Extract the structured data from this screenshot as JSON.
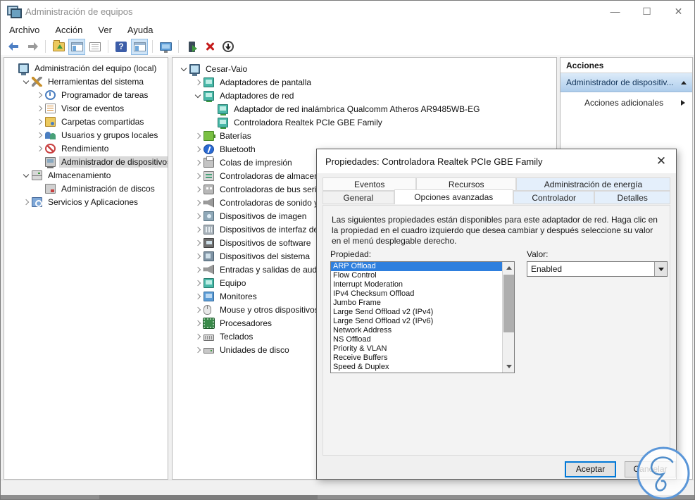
{
  "window": {
    "title": "Administración de equipos",
    "controls": {
      "minimize": "—",
      "maximize": "☐",
      "close": "✕"
    }
  },
  "menu": {
    "items": [
      "Archivo",
      "Acción",
      "Ver",
      "Ayuda"
    ]
  },
  "toolbar": {
    "help_glyph": "?"
  },
  "left_tree": {
    "items": [
      {
        "label": "Administración del equipo (local)",
        "icon": "computer-mgmt",
        "level": 0,
        "expand": "none",
        "selected": false
      },
      {
        "label": "Herramientas del sistema",
        "icon": "tools",
        "level": 1,
        "expand": "down",
        "selected": false
      },
      {
        "label": "Programador de tareas",
        "icon": "scheduler",
        "level": 2,
        "expand": "right",
        "selected": false
      },
      {
        "label": "Visor de eventos",
        "icon": "event-viewer",
        "level": 2,
        "expand": "right",
        "selected": false
      },
      {
        "label": "Carpetas compartidas",
        "icon": "shared-folders",
        "level": 2,
        "expand": "right",
        "selected": false
      },
      {
        "label": "Usuarios y grupos locales",
        "icon": "users",
        "level": 2,
        "expand": "right",
        "selected": false
      },
      {
        "label": "Rendimiento",
        "icon": "performance",
        "level": 2,
        "expand": "right",
        "selected": false
      },
      {
        "label": "Administrador de dispositivos",
        "icon": "device-manager",
        "level": 2,
        "expand": "none",
        "selected": true
      },
      {
        "label": "Almacenamiento",
        "icon": "storage",
        "level": 1,
        "expand": "down",
        "selected": false
      },
      {
        "label": "Administración de discos",
        "icon": "disk-mgmt",
        "level": 2,
        "expand": "none",
        "selected": false
      },
      {
        "label": "Servicios y Aplicaciones",
        "icon": "services",
        "level": 1,
        "expand": "right",
        "selected": false
      }
    ]
  },
  "device_tree": {
    "items": [
      {
        "label": "Cesar-Vaio",
        "icon": "computer",
        "level": 0,
        "expand": "down",
        "selected": false
      },
      {
        "label": "Adaptadores de pantalla",
        "icon": "display",
        "level": 1,
        "expand": "right",
        "selected": false
      },
      {
        "label": "Adaptadores de red",
        "icon": "network",
        "level": 1,
        "expand": "down",
        "selected": false
      },
      {
        "label": "Adaptador de red inalámbrica Qualcomm Atheros AR9485WB-EG",
        "icon": "network",
        "level": 2,
        "expand": "none",
        "selected": false
      },
      {
        "label": "Controladora Realtek PCIe GBE Family",
        "icon": "network",
        "level": 2,
        "expand": "none",
        "selected": false
      },
      {
        "label": "Baterías",
        "icon": "battery",
        "level": 1,
        "expand": "right",
        "selected": false
      },
      {
        "label": "Bluetooth",
        "icon": "bluetooth",
        "level": 1,
        "expand": "right",
        "selected": false
      },
      {
        "label": "Colas de impresión",
        "icon": "printer",
        "level": 1,
        "expand": "right",
        "selected": false
      },
      {
        "label": "Controladoras de almacena",
        "icon": "storage-ctrl",
        "level": 1,
        "expand": "right",
        "selected": false
      },
      {
        "label": "Controladoras de bus serie",
        "icon": "usb",
        "level": 1,
        "expand": "right",
        "selected": false
      },
      {
        "label": "Controladoras de sonido y",
        "icon": "sound",
        "level": 1,
        "expand": "right",
        "selected": false
      },
      {
        "label": "Dispositivos de imagen",
        "icon": "imaging",
        "level": 1,
        "expand": "right",
        "selected": false
      },
      {
        "label": "Dispositivos de interfaz de u",
        "icon": "hid",
        "level": 1,
        "expand": "right",
        "selected": false
      },
      {
        "label": "Dispositivos de software",
        "icon": "software",
        "level": 1,
        "expand": "right",
        "selected": false
      },
      {
        "label": "Dispositivos del sistema",
        "icon": "system",
        "level": 1,
        "expand": "right",
        "selected": false
      },
      {
        "label": "Entradas y salidas de audio",
        "icon": "audio-io",
        "level": 1,
        "expand": "right",
        "selected": false
      },
      {
        "label": "Equipo",
        "icon": "computer2",
        "level": 1,
        "expand": "right",
        "selected": false
      },
      {
        "label": "Monitores",
        "icon": "monitor",
        "level": 1,
        "expand": "right",
        "selected": false
      },
      {
        "label": "Mouse y otros dispositivos",
        "icon": "mouse",
        "level": 1,
        "expand": "right",
        "selected": false
      },
      {
        "label": "Procesadores",
        "icon": "cpu",
        "level": 1,
        "expand": "right",
        "selected": false
      },
      {
        "label": "Teclados",
        "icon": "keyboard",
        "level": 1,
        "expand": "right",
        "selected": false
      },
      {
        "label": "Unidades de disco",
        "icon": "disk",
        "level": 1,
        "expand": "right",
        "selected": false
      }
    ]
  },
  "actions_panel": {
    "header": "Acciones",
    "group_title": "Administrador de dispositiv...",
    "item": "Acciones adicionales"
  },
  "dialog": {
    "title": "Propiedades: Controladora Realtek PCIe GBE Family",
    "close_glyph": "✕",
    "tabs_row1": [
      "Eventos",
      "Recursos",
      "Administración de energía"
    ],
    "tabs_row2": [
      "General",
      "Opciones avanzadas",
      "Controlador",
      "Detalles"
    ],
    "active_tab": "Opciones avanzadas",
    "description": "Las siguientes propiedades están disponibles para este adaptador de red. Haga clic en la propiedad en el cuadro izquierdo que desea cambiar y después seleccione su valor en el menú desplegable derecho.",
    "property_label": "Propiedad:",
    "value_label": "Valor:",
    "properties": [
      "ARP Offload",
      "Flow Control",
      "Interrupt Moderation",
      "IPv4 Checksum Offload",
      "Jumbo Frame",
      "Large Send Offload v2 (IPv4)",
      "Large Send Offload v2 (IPv6)",
      "Network Address",
      "NS Offload",
      "Priority & VLAN",
      "Receive Buffers",
      "Speed & Duplex"
    ],
    "selected_property": "ARP Offload",
    "value": "Enabled",
    "ok_label": "Aceptar",
    "cancel_label": "Cancelar"
  },
  "colors": {
    "selection_blue": "#2e7fde",
    "inactive_selection_gray": "#d9d9d9",
    "focus_button_border": "#0078d7",
    "actions_group_gradient_top": "#dcebf9",
    "actions_group_gradient_bottom": "#aecdec",
    "watermark_blue": "#4f8cc9"
  }
}
